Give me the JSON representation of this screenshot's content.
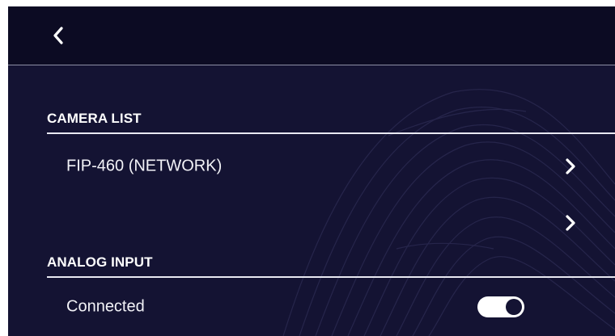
{
  "header": {
    "back_icon": "chevron-left-icon"
  },
  "sections": {
    "camera_list": {
      "title": "CAMERA LIST",
      "items": [
        {
          "label": "FIP-460 (NETWORK)",
          "icon": "chevron-right-icon"
        },
        {
          "label": "",
          "icon": "chevron-right-icon"
        }
      ]
    },
    "analog_input": {
      "title": "ANALOG INPUT",
      "connected": {
        "label": "Connected",
        "toggle_on": true
      }
    }
  },
  "colors": {
    "background": "#141333",
    "topbar": "#0c0b23",
    "text": "#ffffff",
    "divider": "#e9e9f2"
  }
}
